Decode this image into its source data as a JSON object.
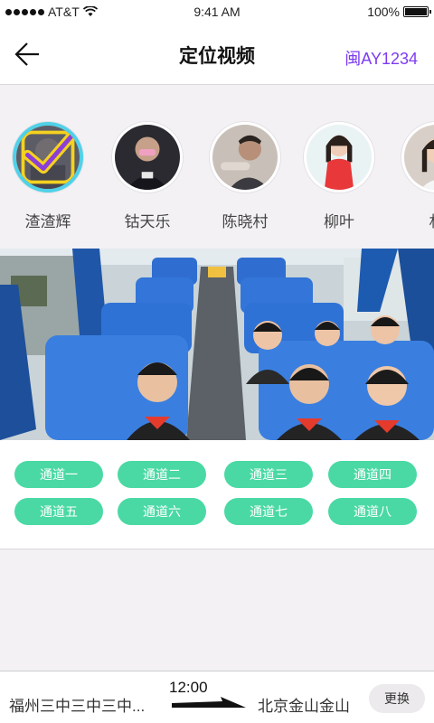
{
  "status_bar": {
    "carrier": "AT&T",
    "time": "9:41 AM",
    "battery": "100%"
  },
  "nav": {
    "title": "定位视频",
    "plate": "闽AY1234",
    "back_icon": "arrow-left-icon"
  },
  "passengers": [
    {
      "name": "渣渣辉",
      "selected": true
    },
    {
      "name": "钴天乐",
      "selected": false
    },
    {
      "name": "陈晓村",
      "selected": false
    },
    {
      "name": "柳叶",
      "selected": false
    },
    {
      "name": "林",
      "selected": false
    }
  ],
  "channels": [
    "通道一",
    "通道二",
    "通道三",
    "通道四",
    "通道五",
    "通道六",
    "通道七",
    "通道八"
  ],
  "route": {
    "from": "福州三中三中三中...",
    "time": "12:00",
    "to": "北京金山金山",
    "swap_label": "更换"
  },
  "colors": {
    "accent_purple": "#7d3cf0",
    "channel_green": "#4ad9a4",
    "ring_cyan": "#4fd1e8",
    "check_yellow": "#f4d21f"
  }
}
